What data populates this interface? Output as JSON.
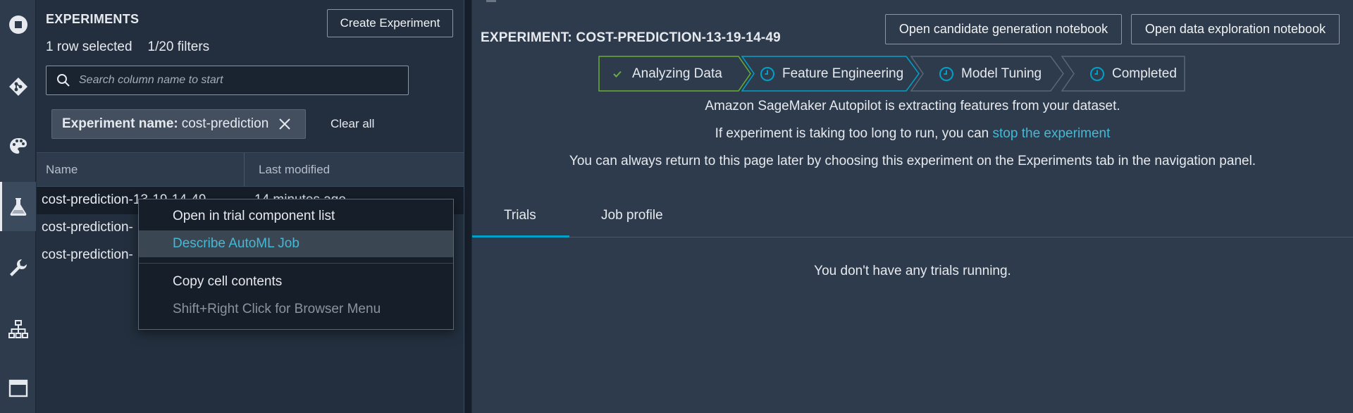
{
  "rail": {
    "items": [
      {
        "icon": "running-icon"
      },
      {
        "icon": "git-icon"
      },
      {
        "icon": "palette-icon"
      },
      {
        "icon": "flask-icon",
        "active": true
      },
      {
        "icon": "wrench-icon"
      },
      {
        "icon": "network-icon"
      },
      {
        "icon": "window-icon"
      }
    ]
  },
  "left_panel": {
    "title": "EXPERIMENTS",
    "create_button": "Create Experiment",
    "rows_selected": "1 row selected",
    "filters_count": "1/20 filters",
    "search_placeholder": "Search column name to start",
    "filter_chip": {
      "label": "Experiment name:",
      "value": "cost-prediction"
    },
    "clear_all": "Clear all",
    "columns": [
      "Name",
      "Last modified"
    ],
    "rows": [
      {
        "name": "cost-prediction-13-19-14-49",
        "modified": "14 minutes ago",
        "selected": true
      },
      {
        "name": "cost-prediction-",
        "modified": ""
      },
      {
        "name": "cost-prediction-",
        "modified": ""
      }
    ]
  },
  "context_menu": {
    "items": [
      {
        "label": "Open in trial component list"
      },
      {
        "label": "Describe AutoML Job",
        "hover": true
      },
      {
        "label": "Copy cell contents"
      },
      {
        "label": "Shift+Right Click for Browser Menu",
        "disabled": true
      }
    ]
  },
  "right_panel": {
    "experiment_title": "EXPERIMENT: COST-PREDICTION-13-19-14-49",
    "buttons": {
      "candidate_nb": "Open candidate generation notebook",
      "exploration_nb": "Open data exploration notebook"
    },
    "steps": [
      {
        "label": "Analyzing Data",
        "state": "done"
      },
      {
        "label": "Feature Engineering",
        "state": "active"
      },
      {
        "label": "Model Tuning",
        "state": "pending"
      },
      {
        "label": "Completed",
        "state": "pending"
      }
    ],
    "status_message": "Amazon SageMaker Autopilot is extracting features from your dataset.",
    "long_run_prefix": "If experiment is taking too long to run, you can ",
    "stop_link": "stop the experiment",
    "return_message": "You can always return to this page later by choosing this experiment on the Experiments tab in the navigation panel.",
    "tabs": [
      "Trials",
      "Job profile"
    ],
    "empty_message": "You don't have any trials running."
  },
  "colors": {
    "accent": "#00a1c9",
    "link": "#44b9d6",
    "success": "#6aaf35"
  }
}
